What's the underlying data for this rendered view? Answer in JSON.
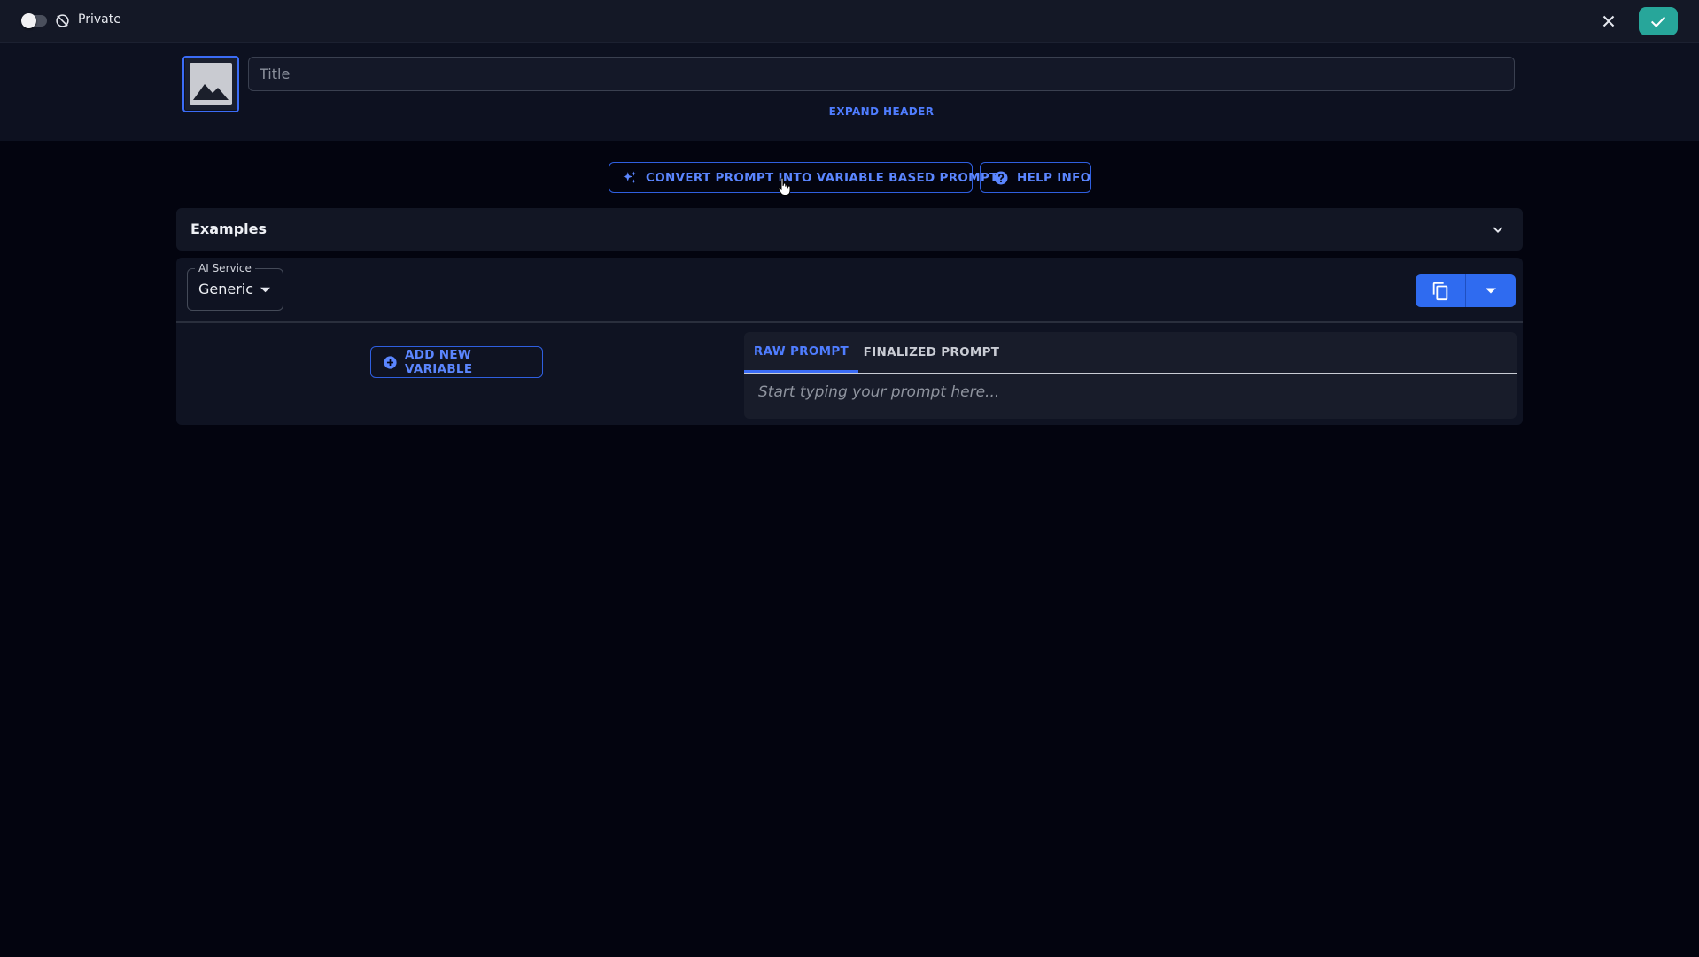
{
  "topbar": {
    "visibility_label": "Private",
    "visibility_toggle_on": false,
    "confirm_color": "#27a69a"
  },
  "header": {
    "title_placeholder": "Title",
    "expand_label": "EXPAND HEADER"
  },
  "actions": {
    "convert_label": "CONVERT PROMPT INTO VARIABLE BASED PROMPT",
    "help_label": "HELP INFO"
  },
  "examples": {
    "label": "Examples"
  },
  "editor": {
    "ai_service_label": "AI Service",
    "ai_service_value": "Generic",
    "add_variable_label": "ADD NEW VARIABLE",
    "tabs": [
      {
        "label": "RAW PROMPT",
        "active": true
      },
      {
        "label": "FINALIZED PROMPT",
        "active": false
      }
    ],
    "prompt_placeholder": "Start typing your prompt here..."
  },
  "colors": {
    "accent": "#3b6cf6",
    "background": "#03040f",
    "panel": "#0f1322"
  },
  "icons": [
    "toggle",
    "public-off-icon",
    "close-icon",
    "check-icon",
    "image-icon",
    "sparkle-icon",
    "help-circle-icon",
    "chevron-down-icon",
    "caret-down-icon",
    "copy-icon",
    "plus-circle-icon",
    "hand-cursor-icon"
  ]
}
